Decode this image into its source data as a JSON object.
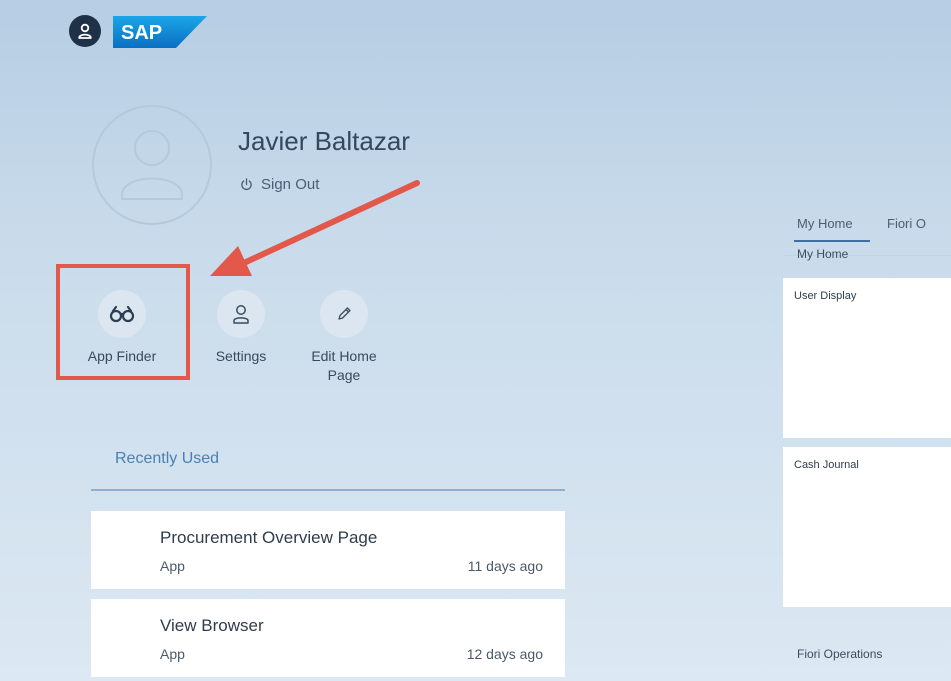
{
  "header": {
    "user_icon": "user-icon",
    "logo_text": "SAP"
  },
  "me_area": {
    "name": "Javier Baltazar",
    "sign_out_label": "Sign Out",
    "sign_out_icon": "power-icon",
    "avatar_icon": "user-placeholder-icon"
  },
  "actions": [
    {
      "label": "App Finder",
      "icon": "binoculars-icon",
      "highlighted": true
    },
    {
      "label": "Settings",
      "icon": "person-icon"
    },
    {
      "label_line1": "Edit Home",
      "label_line2": "Page",
      "icon": "pencil-icon"
    }
  ],
  "recent": {
    "title": "Recently Used",
    "items": [
      {
        "title": "Procurement Overview Page",
        "kind": "App",
        "when": "11 days ago"
      },
      {
        "title": "View Browser",
        "kind": "App",
        "when": "12 days ago"
      }
    ]
  },
  "home": {
    "tabs": [
      {
        "label": "My Home",
        "active": true
      },
      {
        "label": "Fiori O"
      }
    ],
    "sections": [
      {
        "title": "My Home",
        "tiles": [
          {
            "title": "User Display"
          },
          {
            "title": "Cash Journal"
          }
        ]
      },
      {
        "title": "Fiori Operations"
      }
    ]
  },
  "colors": {
    "highlight": "#e2584a",
    "accent": "#3f6fa0",
    "link": "#4a7fb3"
  }
}
